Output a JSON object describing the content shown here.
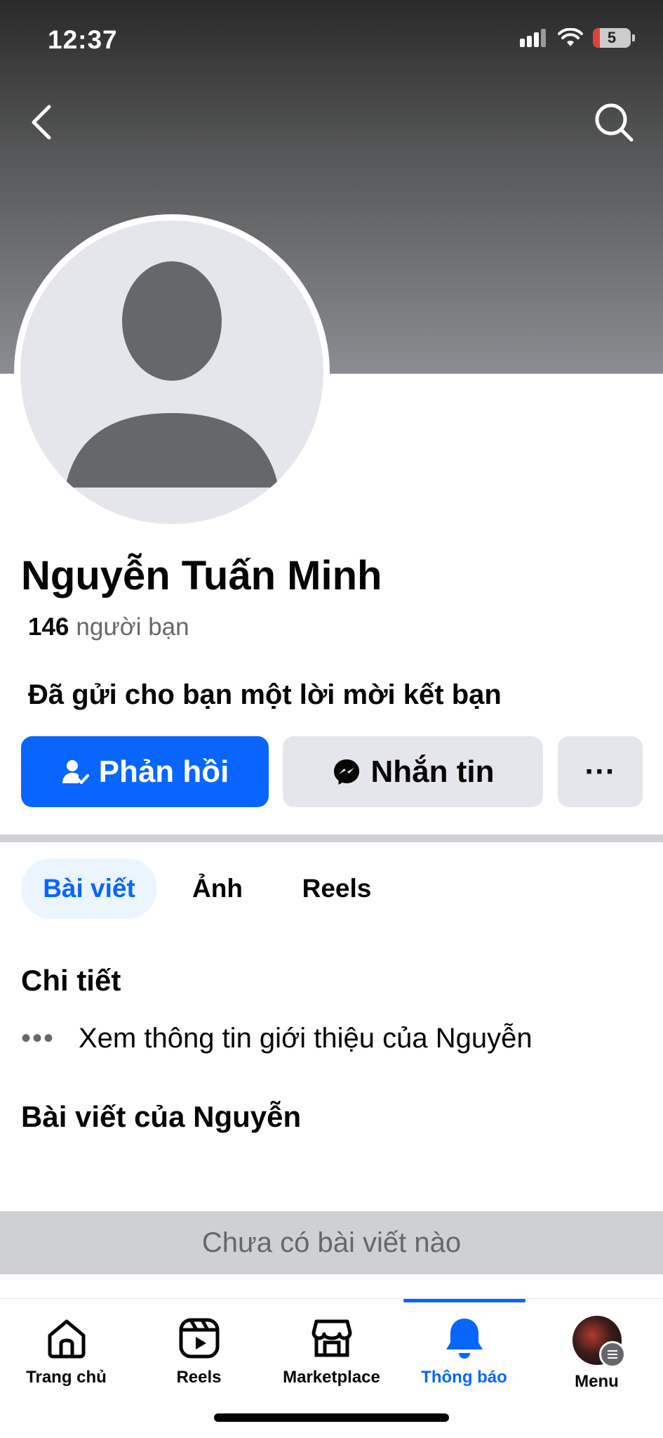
{
  "status_bar": {
    "time": "12:37",
    "battery": "5"
  },
  "profile": {
    "name": "Nguyễn Tuấn Minh",
    "friend_count": "146",
    "friend_label": "người bạn",
    "request_text": "Đã gửi cho bạn một lời mời kết bạn"
  },
  "actions": {
    "reply_label": "Phản hồi",
    "message_label": "Nhắn tin",
    "more_label": "···"
  },
  "tabs": [
    {
      "label": "Bài viết",
      "active": true
    },
    {
      "label": "Ảnh",
      "active": false
    },
    {
      "label": "Reels",
      "active": false
    }
  ],
  "details": {
    "title": "Chi tiết",
    "dots": "•••",
    "about_text": "Xem thông tin giới thiệu của Nguyễn"
  },
  "posts": {
    "title": "Bài viết của Nguyễn",
    "empty_text": "Chưa có bài viết nào"
  },
  "bottom_nav": [
    {
      "label": "Trang chủ",
      "icon": "home-icon"
    },
    {
      "label": "Reels",
      "icon": "reels-icon"
    },
    {
      "label": "Marketplace",
      "icon": "marketplace-icon"
    },
    {
      "label": "Thông báo",
      "icon": "bell-icon",
      "active": true
    },
    {
      "label": "Menu",
      "icon": "menu-avatar"
    }
  ],
  "colors": {
    "accent": "#0866ff",
    "secondary_button": "#e4e6eb",
    "text_muted": "#65676b"
  }
}
